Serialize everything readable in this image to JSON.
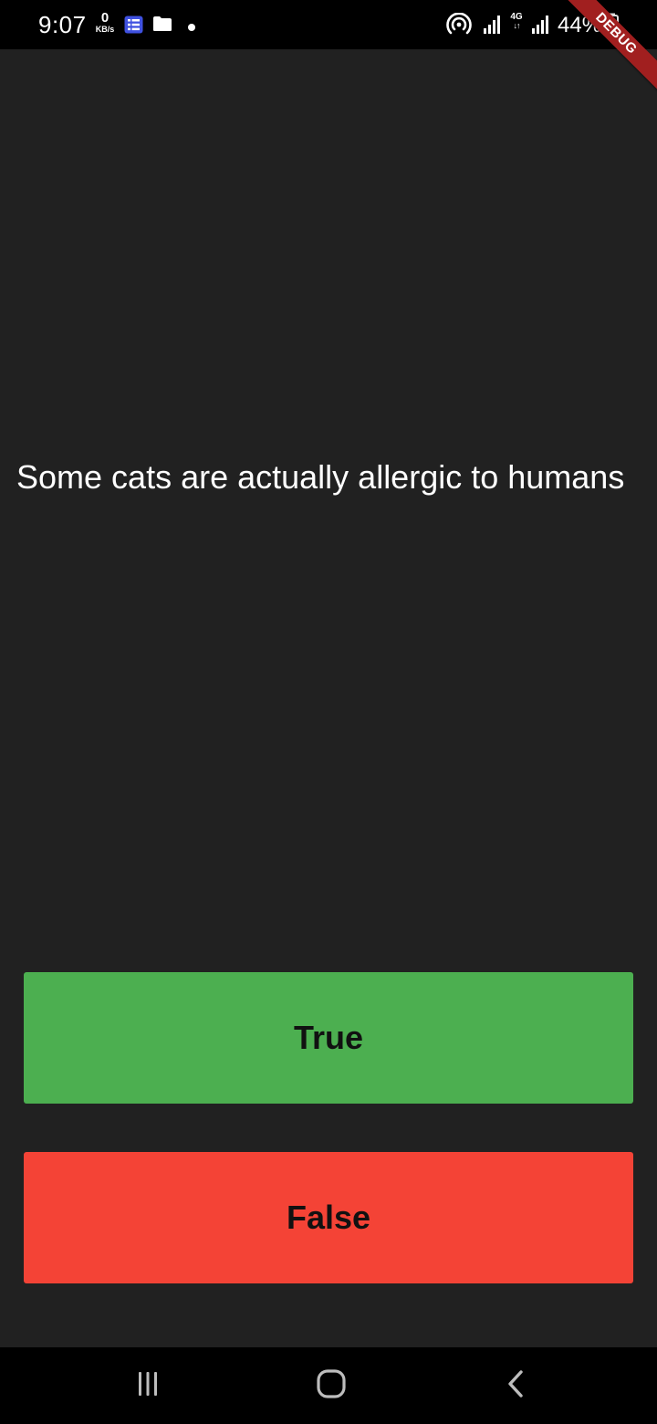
{
  "status_bar": {
    "time": "9:07",
    "net_speed_value": "0",
    "net_speed_unit": "KB/s",
    "network_type": "4G",
    "network_arrows": "↓↑",
    "battery_percent": "44%",
    "icons": [
      "notes-app-icon",
      "folder-icon",
      "notification-dot-icon",
      "hotspot-icon",
      "signal-icon",
      "signal-4g-icon",
      "battery-icon"
    ]
  },
  "debug_banner": {
    "label": "DEBUG"
  },
  "quiz": {
    "question": "Some cats are actually allergic to humans",
    "true_label": "True",
    "false_label": "False"
  },
  "nav_bar": {
    "icons": [
      "recent-apps-icon",
      "home-icon",
      "back-icon"
    ]
  },
  "colors": {
    "background": "#212121",
    "true_button": "#4caf50",
    "false_button": "#f44336",
    "bars": "#000000"
  }
}
